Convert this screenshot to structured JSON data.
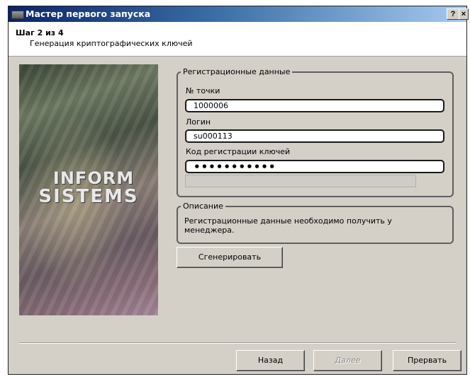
{
  "window": {
    "title": "Мастер первого запуска",
    "help_button": "?",
    "close_button": "×"
  },
  "header": {
    "step": "Шаг 2 из 4",
    "subtitle": "Генерация криптографических ключей"
  },
  "banner": {
    "logo_line1": "INFORM",
    "logo_line2": "SISTEMS"
  },
  "registration": {
    "group_title": "Регистрационные данные",
    "point_label": "№ точки",
    "point_value": "1000006",
    "login_label": "Логин",
    "login_value": "su000113",
    "key_label": "Код регистрации ключей",
    "key_value": "•••••••••••",
    "progress": 0
  },
  "description": {
    "group_title": "Описание",
    "text": "Регистрационные данные необходимо получить у менеджера."
  },
  "buttons": {
    "generate": "Сгенерировать",
    "back": "Назад",
    "next": "Далее",
    "cancel": "Прервать"
  }
}
